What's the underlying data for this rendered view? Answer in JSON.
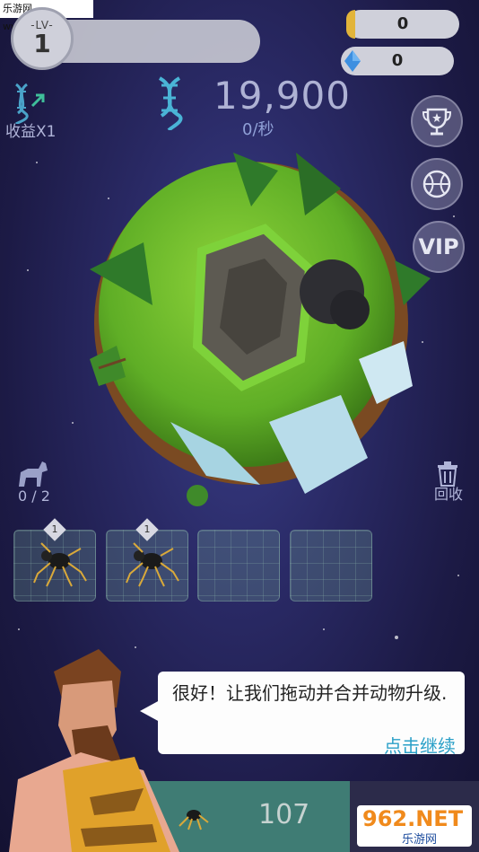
{
  "watermark_top": "乐游网 www.962.net",
  "level": {
    "label": "-LV-",
    "value": "1"
  },
  "resources": {
    "gold": "0",
    "gems": "0"
  },
  "stats": {
    "income_label": "收益X1",
    "dna_count": "19,900",
    "rate": "0/秒"
  },
  "side_buttons": {
    "vip_label": "VIP"
  },
  "animals": {
    "count": "0 / 2",
    "recycle_label": "回收"
  },
  "slots": [
    {
      "badge": "1",
      "has_spider": true
    },
    {
      "badge": "1",
      "has_spider": true
    },
    {
      "badge": "",
      "has_spider": false
    },
    {
      "badge": "",
      "has_spider": false
    }
  ],
  "dialog": {
    "text": "很好！让我们拖动并合并动物升级.",
    "continue": "点击继续"
  },
  "buy": {
    "price": "107"
  },
  "watermark_logo": {
    "main": "962.NET",
    "sub": "乐游网"
  },
  "colors": {
    "accent": "#2aa0c8",
    "gold": "#e2b43a",
    "gem": "#3d8fe0",
    "panel_green": "#3f7c74"
  }
}
